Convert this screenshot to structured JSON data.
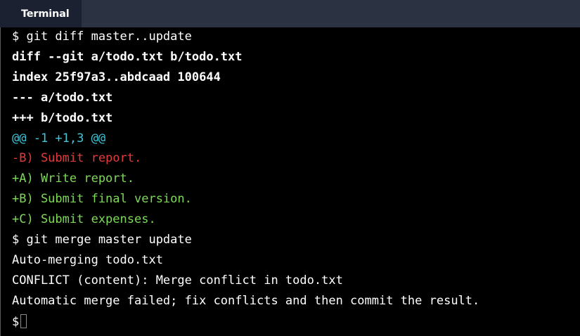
{
  "tab": {
    "title": "Terminal"
  },
  "terminal": {
    "lines": [
      {
        "text": "$ git diff master..update",
        "style": "normal",
        "color": "#ffffff"
      },
      {
        "text": "diff --git a/todo.txt b/todo.txt",
        "style": "bold",
        "color": "#ffffff"
      },
      {
        "text": "index 25f97a3..abdcaad 100644",
        "style": "bold",
        "color": "#ffffff"
      },
      {
        "text": "--- a/todo.txt",
        "style": "bold",
        "color": "#ffffff"
      },
      {
        "text": "+++ b/todo.txt",
        "style": "bold",
        "color": "#ffffff"
      },
      {
        "text": "@@ -1 +1,3 @@",
        "style": "normal",
        "color": "#3fc6d8"
      },
      {
        "text": "-B) Submit report.",
        "style": "normal",
        "color": "#e33b3b"
      },
      {
        "text": "+A) Write report.",
        "style": "normal",
        "color": "#7ed957"
      },
      {
        "text": "+B) Submit final version.",
        "style": "normal",
        "color": "#7ed957"
      },
      {
        "text": "+C) Submit expenses.",
        "style": "normal",
        "color": "#7ed957"
      },
      {
        "text": "$ git merge master update",
        "style": "normal",
        "color": "#ffffff"
      },
      {
        "text": "Auto-merging todo.txt",
        "style": "normal",
        "color": "#ffffff"
      },
      {
        "text": "CONFLICT (content): Merge conflict in todo.txt",
        "style": "normal",
        "color": "#ffffff"
      },
      {
        "text": "Automatic merge failed; fix conflicts and then commit the result.",
        "style": "normal",
        "color": "#ffffff"
      }
    ],
    "prompt": "$"
  }
}
